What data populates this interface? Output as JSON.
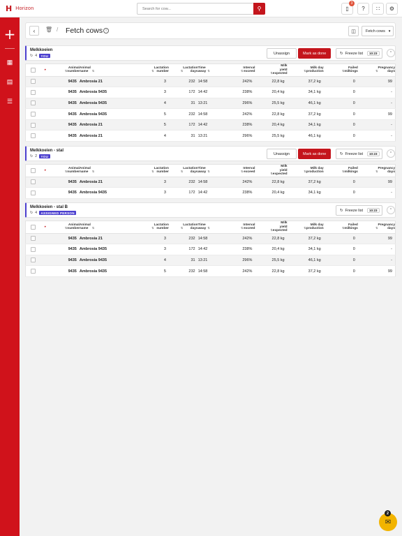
{
  "app": {
    "brand": "Horizon",
    "logo_glyph": "H"
  },
  "search": {
    "placeholder": "Search for cow..."
  },
  "topbar": {
    "notification_count": "3",
    "help_label": "?"
  },
  "page": {
    "title": "Fetch cows",
    "fetch_select": "Fetch cows"
  },
  "columns": [
    "Animal number",
    "Animal name",
    "Lactation number",
    "Lactation days",
    "Time away",
    "Interval exceed",
    "Milk yield expected",
    "Milk day production",
    "Failed milkings",
    "Pregnancy days"
  ],
  "column_lines": [
    [
      "Animal",
      "number"
    ],
    [
      "Animal",
      "name"
    ],
    [
      "Lactation",
      "number"
    ],
    [
      "Lactation",
      "days"
    ],
    [
      "Time",
      "away"
    ],
    [
      "Interval",
      "exceed"
    ],
    [
      "Milk",
      "yield",
      "expected"
    ],
    [
      "Milk day",
      "production"
    ],
    [
      "Failed",
      "milkings"
    ],
    [
      "Pregnancy",
      "days"
    ]
  ],
  "buttons": {
    "unassign": "Unassign",
    "mark_done": "Mark as done",
    "freeze": "Freeze list"
  },
  "groups": [
    {
      "name": "Melkkoeien",
      "count": "4",
      "tag": "YOU",
      "freeze_time": "10:23",
      "assign_actions": true,
      "rows": [
        [
          "9435",
          "Ambrosia 21",
          "3",
          "232",
          "14:58",
          "242%",
          "22,8 kg",
          "37,2 kg",
          "0",
          "99"
        ],
        [
          "9435",
          "Ambrosia 9435",
          "3",
          "172",
          "14:42",
          "238%",
          "20,4 kg",
          "34,1 kg",
          "0",
          "-"
        ],
        [
          "9435",
          "Ambrosia 9435",
          "4",
          "31",
          "13:21",
          "296%",
          "25,5 kg",
          "46,1 kg",
          "0",
          "-"
        ],
        [
          "9435",
          "Ambrosia 9435",
          "5",
          "232",
          "14:58",
          "242%",
          "22,8 kg",
          "37,2 kg",
          "0",
          "99"
        ],
        [
          "9435",
          "Ambrosia 21",
          "5",
          "172",
          "14:42",
          "238%",
          "20,4 kg",
          "34,1 kg",
          "0",
          "-"
        ],
        [
          "9435",
          "Ambrosia 21",
          "4",
          "31",
          "13:21",
          "296%",
          "25,5 kg",
          "46,1 kg",
          "0",
          "-"
        ]
      ]
    },
    {
      "name": "Melkkoeien - stal",
      "count": "2",
      "tag": "YOU",
      "freeze_time": "10:23",
      "assign_actions": true,
      "rows": [
        [
          "9435",
          "Ambrosia 21",
          "3",
          "232",
          "14:58",
          "242%",
          "22,8 kg",
          "37,2 kg",
          "0",
          "99"
        ],
        [
          "9435",
          "Ambrosia 9435",
          "3",
          "172",
          "14:42",
          "238%",
          "20,4 kg",
          "34,1 kg",
          "0",
          "-"
        ]
      ]
    },
    {
      "name": "Melkkoeien - stal B",
      "count": "4",
      "tag": "ASSIGNED PERSON",
      "freeze_time": "10:23",
      "assign_actions": false,
      "rows": [
        [
          "9435",
          "Ambrosia 21",
          "3",
          "232",
          "14:58",
          "242%",
          "22,8 kg",
          "37,2 kg",
          "0",
          "99"
        ],
        [
          "9435",
          "Ambrosia 9435",
          "3",
          "172",
          "14:42",
          "238%",
          "20,4 kg",
          "34,1 kg",
          "0",
          "-"
        ],
        [
          "9435",
          "Ambrosia 9435",
          "4",
          "31",
          "13:21",
          "296%",
          "25,5 kg",
          "46,1 kg",
          "0",
          "-"
        ],
        [
          "9435",
          "Ambrosia 9435",
          "5",
          "232",
          "14:58",
          "242%",
          "22,8 kg",
          "37,2 kg",
          "0",
          "99"
        ]
      ]
    }
  ],
  "chat": {
    "badge": "2"
  },
  "colors": {
    "brand_red": "#c4151c",
    "sidebar_red": "#d0121b",
    "tag_purple": "#4b3fcf",
    "chat_yellow": "#f2b400"
  },
  "icons": [
    "bell-icon",
    "help-icon",
    "apps-grid-icon",
    "settings-icon",
    "search-icon",
    "plus-icon",
    "dashboard-icon",
    "report-icon",
    "filters-icon",
    "back-arrow-icon",
    "trash-icon",
    "info-icon",
    "columns-icon",
    "refresh-icon",
    "chevron-up-icon",
    "chat-icon",
    "cow-count-icon"
  ]
}
